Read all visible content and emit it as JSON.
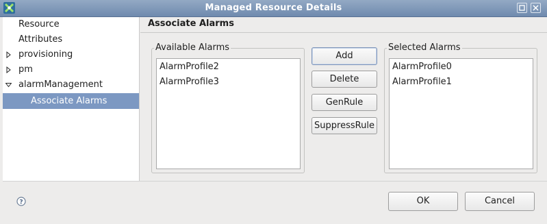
{
  "window": {
    "title": "Managed Resource Details"
  },
  "nav": {
    "items": [
      {
        "label": "Resource",
        "expander": "none"
      },
      {
        "label": "Attributes",
        "expander": "none"
      },
      {
        "label": "provisioning",
        "expander": "collapsed"
      },
      {
        "label": "pm",
        "expander": "collapsed"
      },
      {
        "label": "alarmManagement",
        "expander": "expanded"
      },
      {
        "label": "Associate Alarms",
        "expander": "none",
        "selected": true
      }
    ]
  },
  "page": {
    "title": "Associate Alarms"
  },
  "available": {
    "title": "Available Alarms",
    "items": [
      "AlarmProfile2",
      "AlarmProfile3"
    ]
  },
  "selected": {
    "title": "Selected Alarms",
    "items": [
      "AlarmProfile0",
      "AlarmProfile1"
    ]
  },
  "actions": {
    "add": "Add",
    "delete": "Delete",
    "genrule": "GenRule",
    "suppress": "SuppressRule"
  },
  "footer": {
    "ok": "OK",
    "cancel": "Cancel"
  },
  "icons": {
    "app": "app-logo-icon",
    "maximize": "maximize-icon",
    "close": "close-icon",
    "help": "help-icon"
  },
  "colors": {
    "titlebar": "#7b95b8",
    "selection": "#7c98c2"
  }
}
